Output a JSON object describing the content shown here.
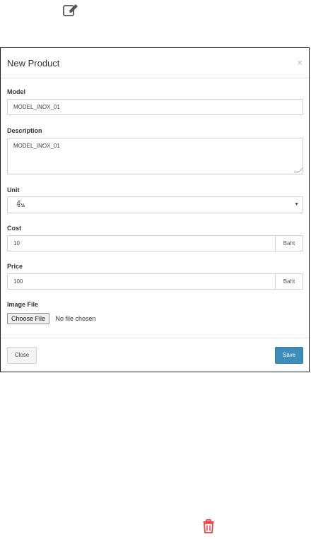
{
  "toolbar": {
    "edit_icon": "edit-icon",
    "delete_icon": "trash-icon"
  },
  "modal": {
    "title": "New Product",
    "close_symbol": "×",
    "model": {
      "label": "Model",
      "value": "MODEL_INOX_01"
    },
    "description": {
      "label": "Description",
      "value": "MODEL_INOX_01"
    },
    "unit": {
      "label": "Unit",
      "selected": "ชิ้น"
    },
    "cost": {
      "label": "Cost",
      "value": "10",
      "addon": "Baht"
    },
    "price": {
      "label": "Price",
      "value": "100",
      "addon": "Baht"
    },
    "image_file": {
      "label": "Image File",
      "button": "Choose File",
      "status": "No file chosen"
    },
    "footer": {
      "close_label": "Close",
      "save_label": "Save"
    }
  },
  "colors": {
    "primary": "#3c8dbc",
    "danger": "#e8424b",
    "border": "#d2d2d2"
  }
}
